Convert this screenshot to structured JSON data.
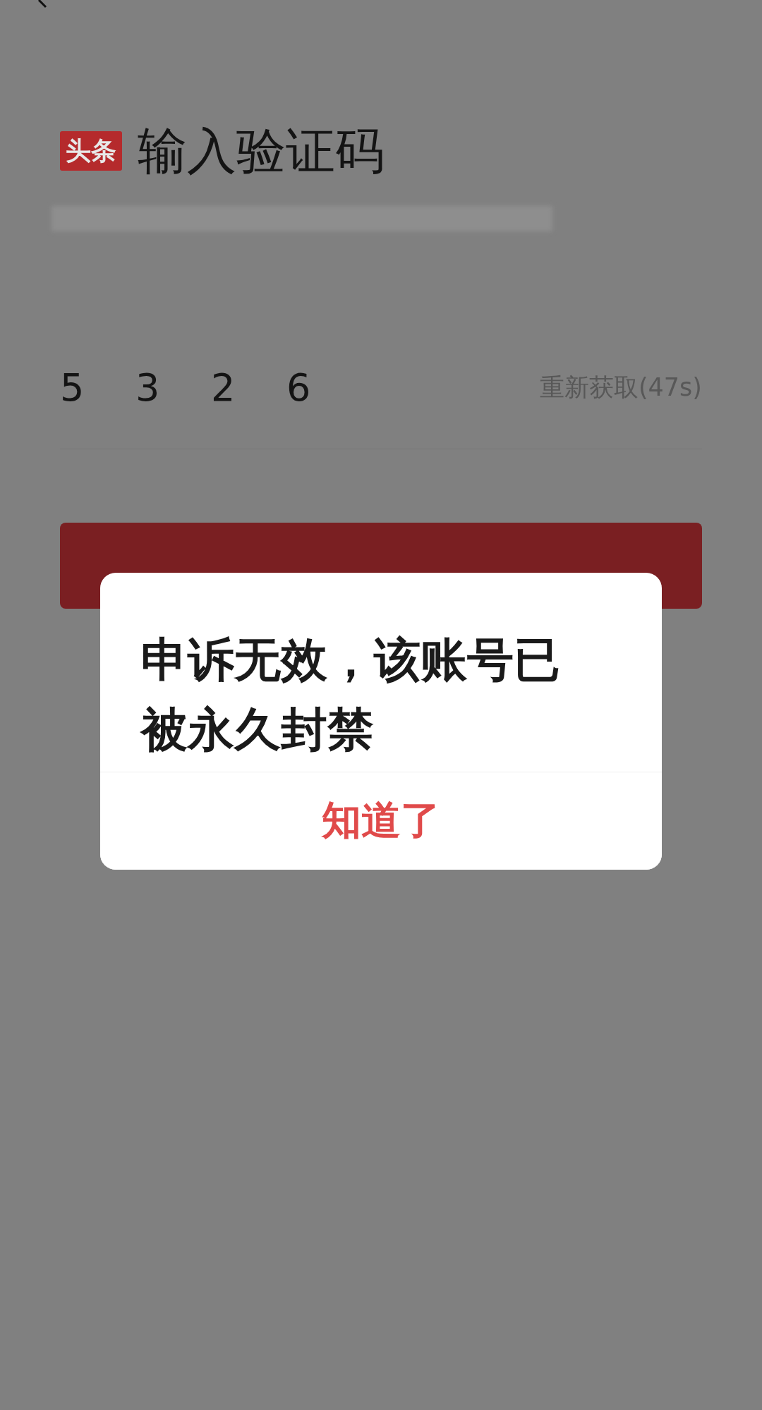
{
  "header": {
    "logo": "头条",
    "title": "输入验证码"
  },
  "code": {
    "digits": [
      "5",
      "3",
      "2",
      "6"
    ],
    "resend": "重新获取(47s)"
  },
  "dialog": {
    "message": "申诉无效，该账号已被永久封禁",
    "button": "知道了"
  }
}
